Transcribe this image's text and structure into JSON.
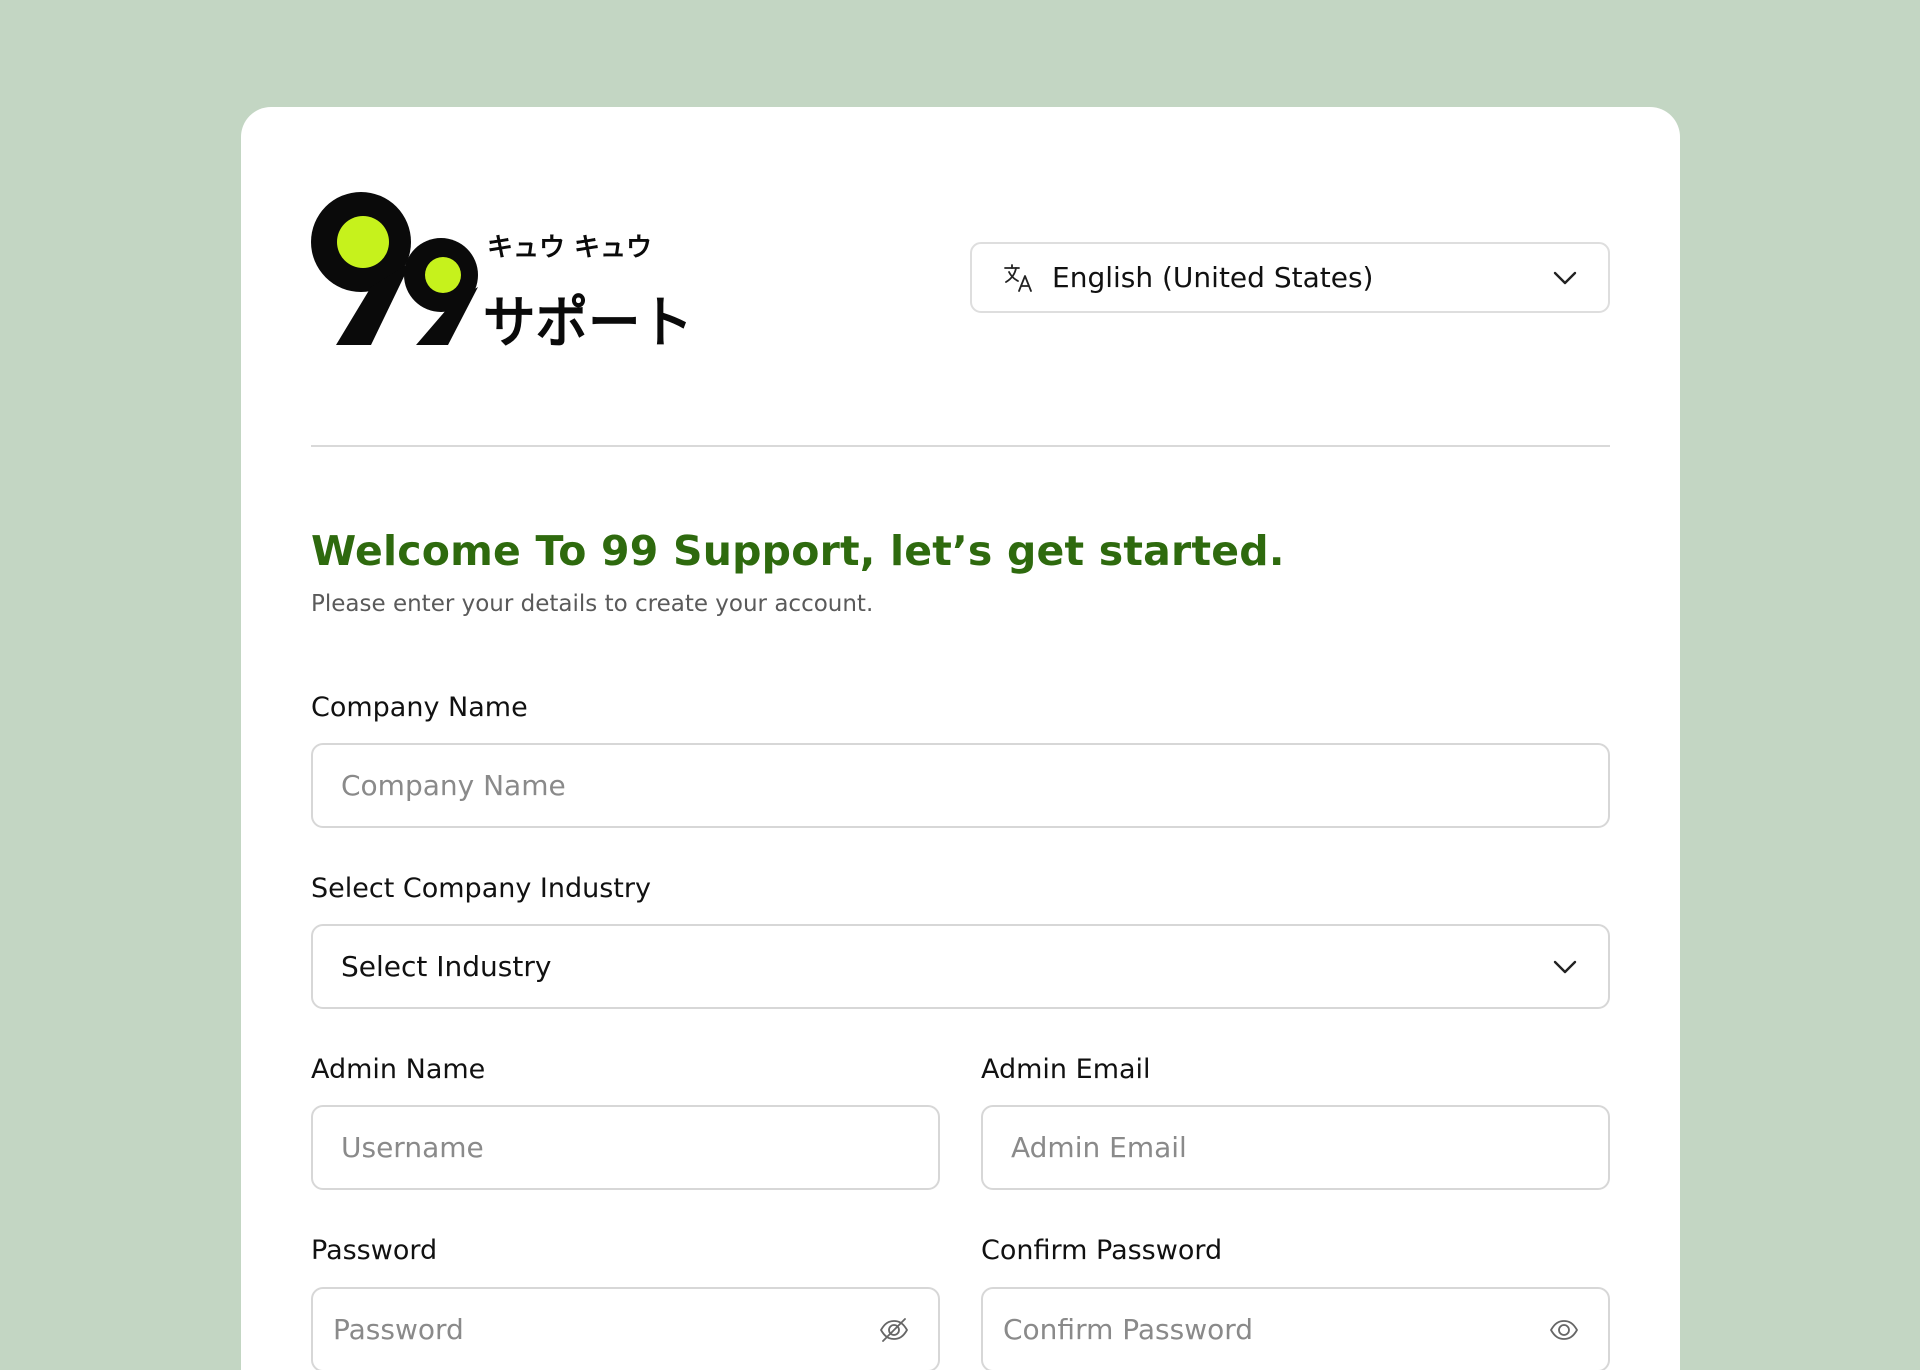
{
  "brand": {
    "logo_digits": "99",
    "logo_kana_small": "キュウ キュウ",
    "logo_kana_large": "サポート",
    "accent_color": "#c6f21c",
    "title_color": "#2e6a0e"
  },
  "language": {
    "icon": "translate-icon",
    "selected": "English (United States)"
  },
  "header": {
    "title": "Welcome To 99 Support, let’s get started.",
    "subtitle": "Please enter your details to create your account."
  },
  "form": {
    "company_name": {
      "label": "Company Name",
      "placeholder": "Company Name"
    },
    "industry": {
      "label": "Select Company Industry",
      "selected": "Select Industry"
    },
    "admin_name": {
      "label": "Admin Name",
      "placeholder": "Username"
    },
    "admin_email": {
      "label": "Admin Email",
      "placeholder": "Admin Email"
    },
    "password": {
      "label": "Password",
      "placeholder": "Password",
      "icon": "eye-off-icon"
    },
    "confirm_password": {
      "label": "Confirm Password",
      "placeholder": "Confirm Password",
      "icon": "eye-icon"
    }
  }
}
